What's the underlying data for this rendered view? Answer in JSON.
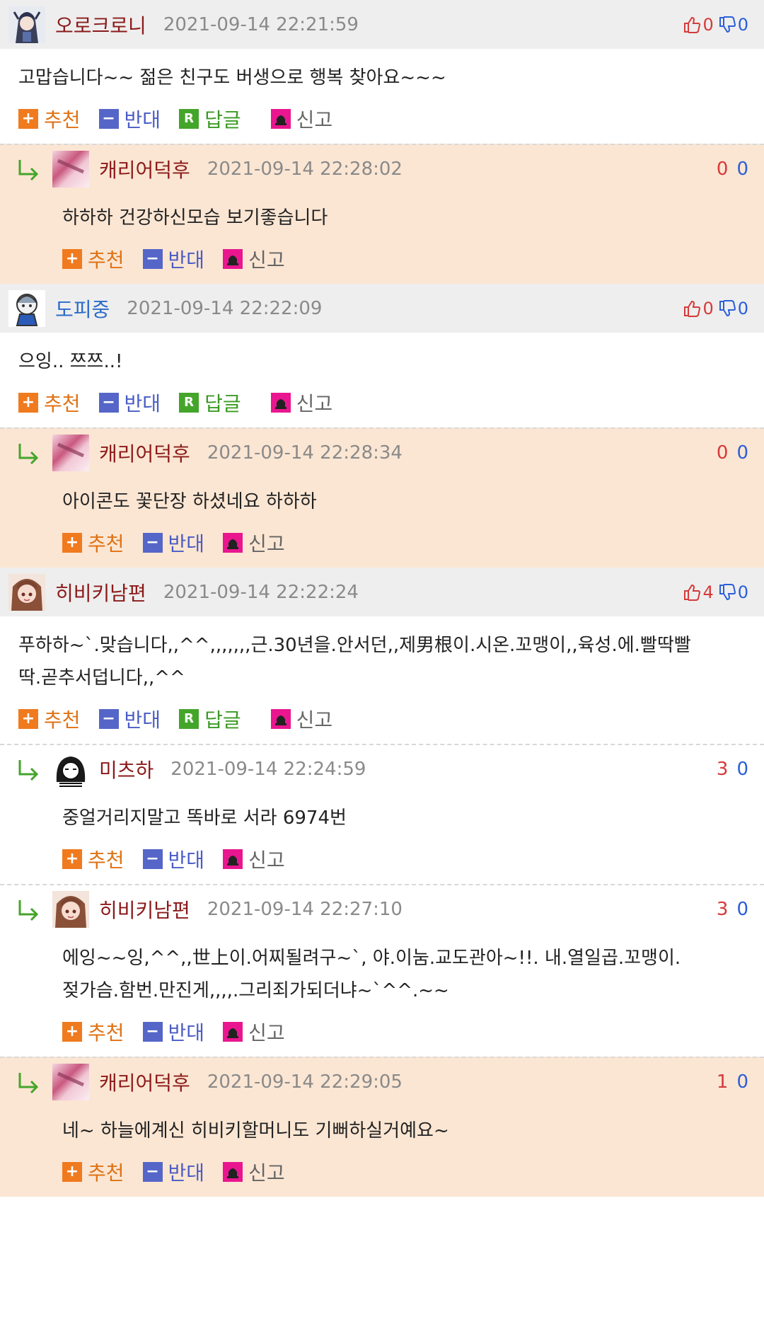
{
  "actions": {
    "recommend": "추천",
    "oppose": "반대",
    "reply": "답글",
    "report": "신고",
    "reply_badge": "R"
  },
  "colors": {
    "header_bg": "#eeeeee",
    "reply_bg": "#fbe6d3",
    "nick_red": "#8b1a1a",
    "nick_blue": "#2a6bc9",
    "recommend": "#f07a1e",
    "oppose": "#5566c8",
    "reply": "#44a52b",
    "report": "#e9168f"
  },
  "comments": [
    {
      "nick": "오로크로니",
      "date": "2021-09-14 22:21:59",
      "up": "0",
      "down": "0",
      "body": "고맙습니다~~ 젊은 친구도 버생으로 행복 찾아요~~~",
      "avatar_icon": "anime-girl-avatar-icon"
    },
    {
      "nick": "캐리어덕후",
      "date": "2021-09-14 22:28:02",
      "up": "0",
      "down": "0",
      "body": "하하하 건강하신모습 보기좋습니다",
      "avatar_icon": "blurred-pink-avatar-icon"
    },
    {
      "nick": "도피중",
      "date": "2021-09-14 22:22:09",
      "up": "0",
      "down": "0",
      "body": "으잉.. 쯔쯔..!",
      "avatar_icon": "chibi-character-avatar-icon"
    },
    {
      "nick": "캐리어덕후",
      "date": "2021-09-14 22:28:34",
      "up": "0",
      "down": "0",
      "body": "아이콘도 꽃단장 하셨네요 하하하",
      "avatar_icon": "blurred-pink-avatar-icon"
    },
    {
      "nick": "히비키남편",
      "date": "2021-09-14 22:22:24",
      "up": "4",
      "down": "0",
      "body_line1": "푸하하~`.맞습니다,,^^,,,,,,,근.30년을.안서던,,제男根이.시온.꼬맹이,,육성.에.빨딱빨",
      "body_line2": "딱.곧추서덥니다,,^^",
      "avatar_icon": "brown-hair-girl-avatar-icon"
    },
    {
      "nick": "미츠하",
      "date": "2021-09-14 22:24:59",
      "up": "3",
      "down": "0",
      "body": "중얼거리지말고 똑바로 서라 6974번",
      "avatar_icon": "sketch-character-avatar-icon"
    },
    {
      "nick": "히비키남편",
      "date": "2021-09-14 22:27:10",
      "up": "3",
      "down": "0",
      "body_line1": "에잉~~잉,^^,,世上이.어찌될려구~`, 야.이눔.교도관아~!!. 내.열일곱.꼬맹이.",
      "body_line2": "젖가슴.함번.만진게,,,,.그리죄가되더냐~`^^.~~",
      "avatar_icon": "brown-hair-girl-avatar-icon"
    },
    {
      "nick": "캐리어덕후",
      "date": "2021-09-14 22:29:05",
      "up": "1",
      "down": "0",
      "body": "네~ 하늘에계신 히비키할머니도 기뻐하실거예요~",
      "avatar_icon": "blurred-pink-avatar-icon"
    }
  ]
}
